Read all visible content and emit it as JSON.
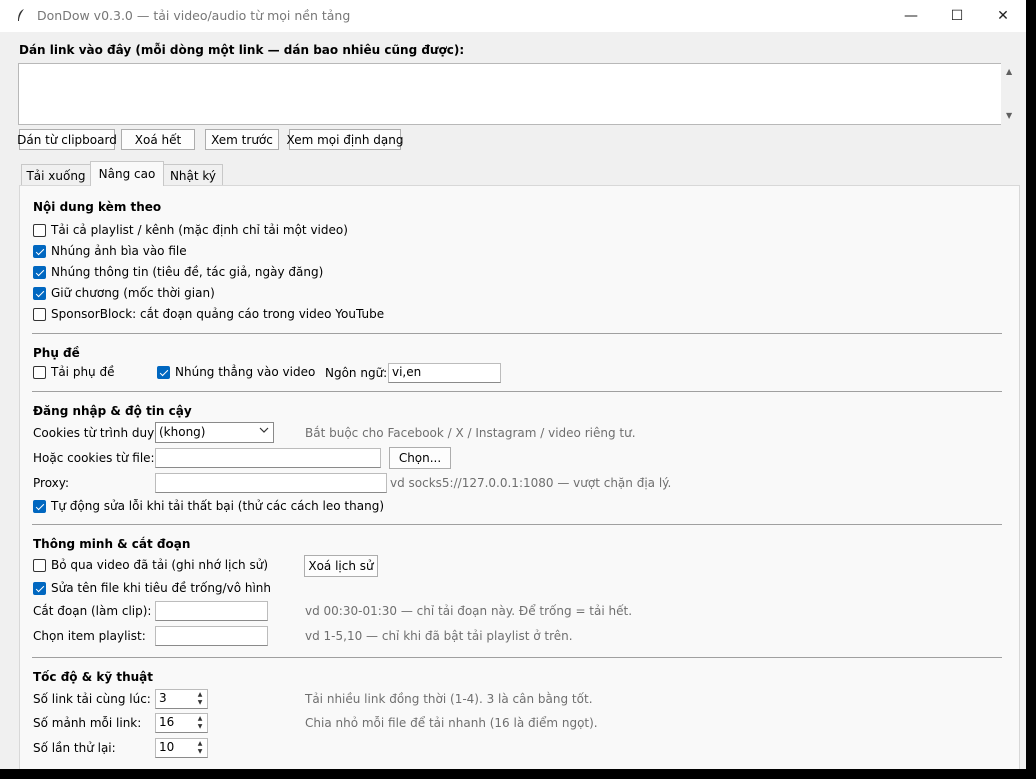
{
  "window": {
    "title": "DonDow v0.3.0 — tải video/audio từ mọi nền tảng",
    "minimize_glyph": "—",
    "maximize_glyph": "☐",
    "close_glyph": "✕"
  },
  "link_input": {
    "label": "Dán link vào đây (mỗi dòng một link — dán bao nhiêu cũng được):",
    "value": ""
  },
  "toolbar": {
    "paste": "Dán từ clipboard",
    "clear": "Xoá hết",
    "preview": "Xem trước",
    "formats": "Xem mọi định dạng"
  },
  "tabs": [
    "Tải xuống",
    "Nâng cao",
    "Nhật ký"
  ],
  "active_tab": "Nâng cao",
  "extras": {
    "heading": "Nội dung kèm theo",
    "items": [
      {
        "label": "Tải cả playlist / kênh (mặc định chỉ tải một video)",
        "checked": false
      },
      {
        "label": "Nhúng ảnh bìa vào file",
        "checked": true
      },
      {
        "label": "Nhúng thông tin (tiêu đề, tác giả, ngày đăng)",
        "checked": true
      },
      {
        "label": "Giữ chương (mốc thời gian)",
        "checked": true
      },
      {
        "label": "SponsorBlock: cắt đoạn quảng cáo trong video YouTube",
        "checked": false
      }
    ]
  },
  "subtitles": {
    "heading": "Phụ đề",
    "download": {
      "label": "Tải phụ đề",
      "checked": false
    },
    "embed": {
      "label": "Nhúng thẳng vào video",
      "checked": true
    },
    "language_label": "Ngôn ngữ:",
    "language_value": "vi,en"
  },
  "login": {
    "heading": "Đăng nhập & độ tin cậy",
    "cookies_browser_label": "Cookies từ trình duyệt:",
    "cookies_browser_value": "(khong)",
    "cookies_browser_hint": "Bắt buộc cho Facebook / X / Instagram / video riêng tư.",
    "cookies_file_label": "Hoặc cookies từ file:",
    "cookies_file_value": "",
    "choose_button": "Chọn...",
    "proxy_label": "Proxy:",
    "proxy_value": "",
    "proxy_hint": "vd socks5://127.0.0.1:1080 — vượt chặn địa lý.",
    "auto_fix": {
      "label": "Tự động sửa lỗi khi tải thất bại (thử các cách leo thang)",
      "checked": true
    }
  },
  "smart": {
    "heading": "Thông minh & cắt đoạn",
    "skip": {
      "label": "Bỏ qua video đã tải (ghi nhớ lịch sử)",
      "checked": false
    },
    "clear_history": "Xoá lịch sử",
    "rename": {
      "label": "Sửa tên file khi tiêu đề trống/vô hình",
      "checked": true
    },
    "clip_label": "Cắt đoạn (làm clip):",
    "clip_value": "",
    "clip_hint": "vd 00:30-01:30 — chỉ tải đoạn này. Để trống = tải hết.",
    "items_label": "Chọn item playlist:",
    "items_value": "",
    "items_hint": "vd 1-5,10 — chỉ khi đã bật tải playlist ở trên."
  },
  "speed": {
    "heading": "Tốc độ & kỹ thuật",
    "rows": [
      {
        "label": "Số link tải cùng lúc:",
        "value": "3",
        "hint": "Tải nhiều link đồng thời (1-4). 3 là cân bằng tốt."
      },
      {
        "label": "Số mảnh mỗi link:",
        "value": "16",
        "hint": "Chia nhỏ mỗi file để tải nhanh (16 là điểm ngọt)."
      },
      {
        "label": "Số lần thử lại:",
        "value": "10",
        "hint": ""
      }
    ]
  }
}
